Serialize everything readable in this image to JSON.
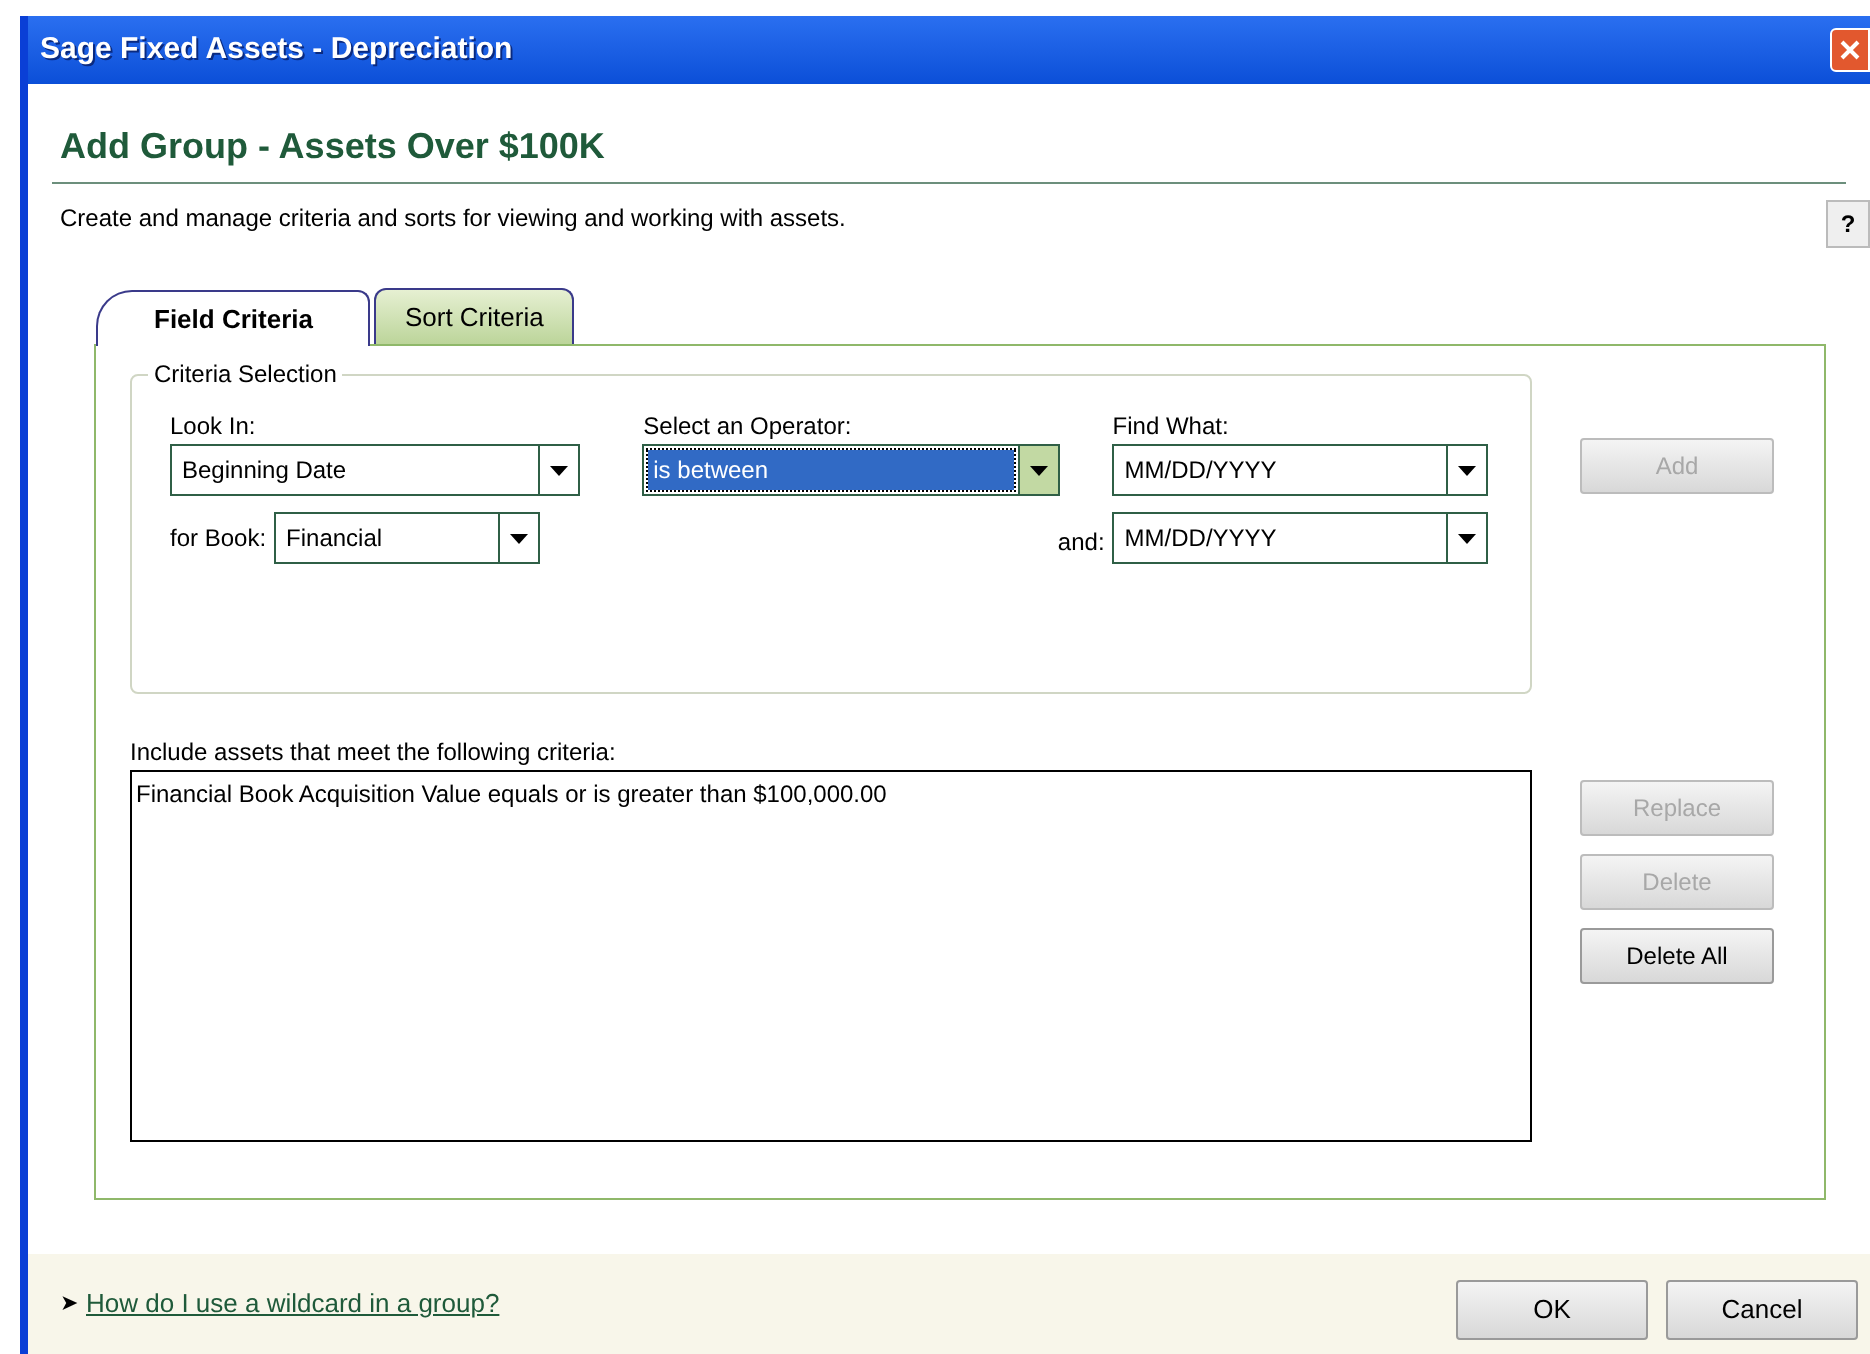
{
  "window": {
    "title": "Sage Fixed Assets - Depreciation"
  },
  "heading": "Add Group - Assets Over $100K",
  "description": "Create and manage criteria and sorts for viewing and working with assets.",
  "help_button": "?",
  "tabs": [
    {
      "label": "Field Criteria",
      "selected": true
    },
    {
      "label": "Sort Criteria",
      "selected": false
    }
  ],
  "criteria_selection": {
    "title": "Criteria Selection",
    "look_in": {
      "label": "Look In:",
      "value": "Beginning Date",
      "focused": false
    },
    "operator": {
      "label": "Select an Operator:",
      "value": "is between",
      "focused": true
    },
    "find_what": {
      "label": "Find What:",
      "value": "MM/DD/YYYY",
      "focused": false
    },
    "for_book": {
      "label": "for Book:",
      "value": "Financial",
      "focused": false
    },
    "and": {
      "label": "and:",
      "value": "MM/DD/YYYY",
      "focused": false
    }
  },
  "add_button": {
    "label": "Add",
    "disabled": true
  },
  "criteria_list": {
    "label": "Include assets that meet the following criteria:",
    "items": [
      "Financial Book Acquisition Value equals or is greater than $100,000.00"
    ]
  },
  "list_buttons": [
    {
      "label": "Replace",
      "disabled": true
    },
    {
      "label": "Delete",
      "disabled": true
    },
    {
      "label": "Delete All",
      "disabled": false
    }
  ],
  "footer": {
    "link_marker": "➤",
    "link": "How do I use a wildcard in a group?",
    "buttons": [
      "OK",
      "Cancel"
    ]
  }
}
